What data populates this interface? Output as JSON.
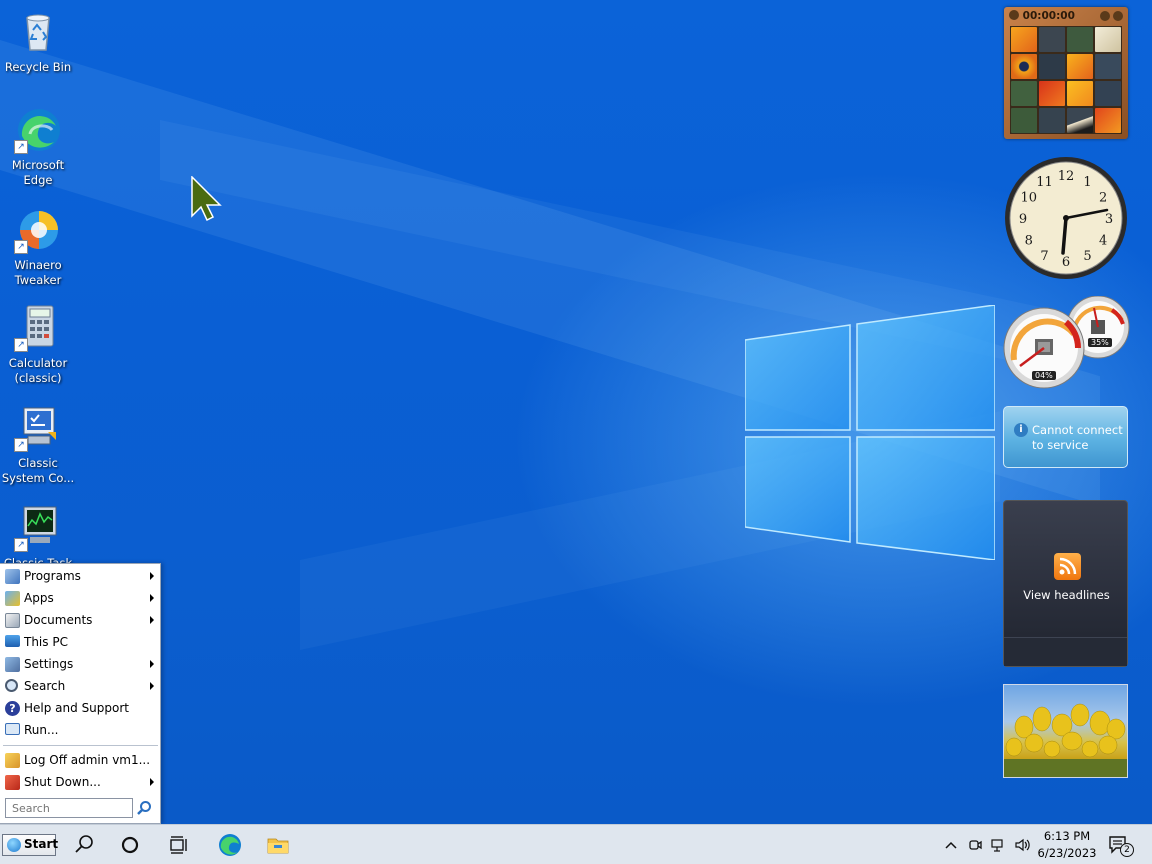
{
  "desktop": {
    "icons": [
      {
        "label": "Recycle Bin",
        "icon": "recycle-bin-icon"
      },
      {
        "label": "Microsoft Edge",
        "icon": "edge-icon"
      },
      {
        "label": "Winaero Tweaker",
        "icon": "winaero-tweaker-icon"
      },
      {
        "label": "Calculator (classic)",
        "icon": "calculator-icon"
      },
      {
        "label": "Classic System Co...",
        "icon": "system-control-icon"
      },
      {
        "label": "Classic Task",
        "icon": "task-manager-icon"
      }
    ]
  },
  "gadgets": {
    "puzzle": {
      "timer": "00:00:00"
    },
    "clock": {
      "numbers": [
        "12",
        "1",
        "2",
        "3",
        "4",
        "5",
        "6",
        "7",
        "8",
        "9",
        "10",
        "11"
      ]
    },
    "meter": {
      "cpu_percent": "04%",
      "memory_percent": "35%"
    },
    "weather": {
      "message": "Cannot connect to service",
      "line1": "Cannot connect",
      "line2": "to service"
    },
    "feed": {
      "label": "View headlines"
    },
    "slideshow": {
      "icon": "tulips-photo"
    }
  },
  "start_menu": {
    "items": [
      {
        "label": "Programs",
        "submenu": true,
        "icon": "programs-icon"
      },
      {
        "label": "Apps",
        "submenu": true,
        "icon": "apps-icon"
      },
      {
        "label": "Documents",
        "submenu": true,
        "icon": "documents-icon"
      },
      {
        "label": "This PC",
        "submenu": false,
        "icon": "this-pc-icon"
      },
      {
        "label": "Settings",
        "submenu": true,
        "icon": "settings-icon"
      },
      {
        "label": "Search",
        "submenu": true,
        "icon": "search-icon"
      },
      {
        "label": "Help and Support",
        "submenu": false,
        "icon": "help-icon"
      },
      {
        "label": "Run...",
        "submenu": false,
        "icon": "run-icon"
      },
      {
        "label": "Log Off admin vm1...",
        "submenu": false,
        "icon": "log-off-icon"
      },
      {
        "label": "Shut Down...",
        "submenu": true,
        "icon": "shutdown-icon"
      }
    ],
    "search_placeholder": "Search"
  },
  "taskbar": {
    "start_label": "Start",
    "time": "6:13 PM",
    "date": "6/23/2023",
    "notification_count": "2"
  },
  "colors": {
    "desktop": "#0a5fd4",
    "taskbar": "#dfe6ee",
    "accent": "#1f7bd0"
  }
}
